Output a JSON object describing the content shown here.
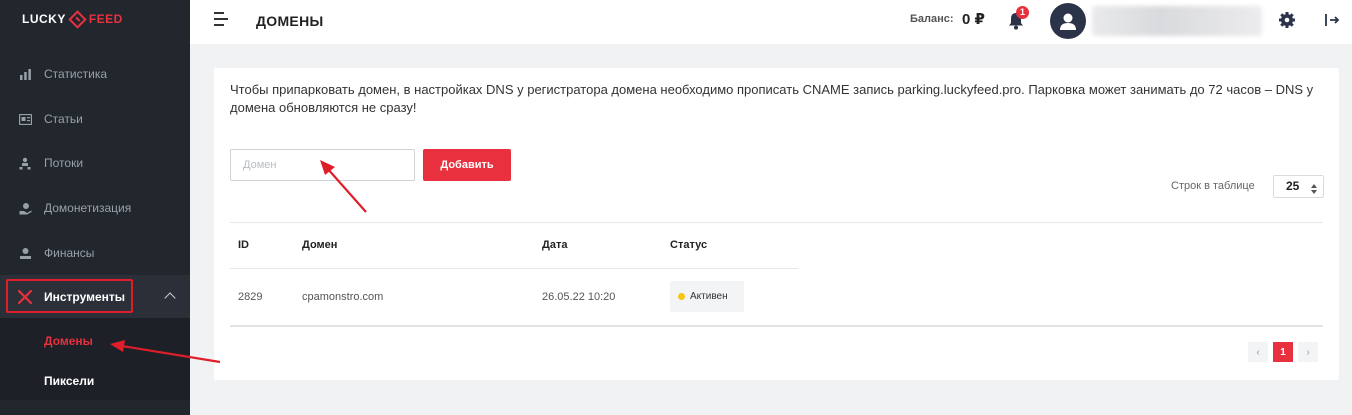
{
  "brand": {
    "part1": "LUCKY",
    "part2": "FEED"
  },
  "sidebar": {
    "items": [
      {
        "label": "Статистика",
        "icon": "chart-icon"
      },
      {
        "label": "Статьи",
        "icon": "articles-icon"
      },
      {
        "label": "Потоки",
        "icon": "flows-icon"
      },
      {
        "label": "Домонетизация",
        "icon": "monetization-icon"
      },
      {
        "label": "Финансы",
        "icon": "finance-icon"
      },
      {
        "label": "Инструменты",
        "icon": "tools-icon"
      }
    ],
    "subitems": [
      {
        "label": "Домены"
      },
      {
        "label": "Пиксели"
      }
    ]
  },
  "header": {
    "title": "ДОМЕНЫ",
    "balance_label": "Баланс:",
    "balance_value": "0 ₽",
    "notifications_count": "1"
  },
  "main": {
    "notice": "Чтобы припарковать домен, в настройках DNS у регистратора домена необходимо прописать CNAME запись parking.luckyfeed.pro. Парковка может занимать до 72 часов – DNS у домена обновляются не сразу!",
    "domain_input_placeholder": "Домен",
    "add_button": "Добавить",
    "rows_label": "Строк в таблице",
    "rows_value": "25",
    "table": {
      "headers": [
        "ID",
        "Домен",
        "Дата",
        "Статус"
      ],
      "rows": [
        {
          "id": "2829",
          "domain": "cpamonstro.com",
          "date": "26.05.22 10:20",
          "status": "Активен"
        }
      ]
    },
    "pagination": {
      "current": "1"
    }
  },
  "colors": {
    "accent": "#e8303e",
    "sidebar": "#22272e",
    "status_active": "#f5c518"
  }
}
